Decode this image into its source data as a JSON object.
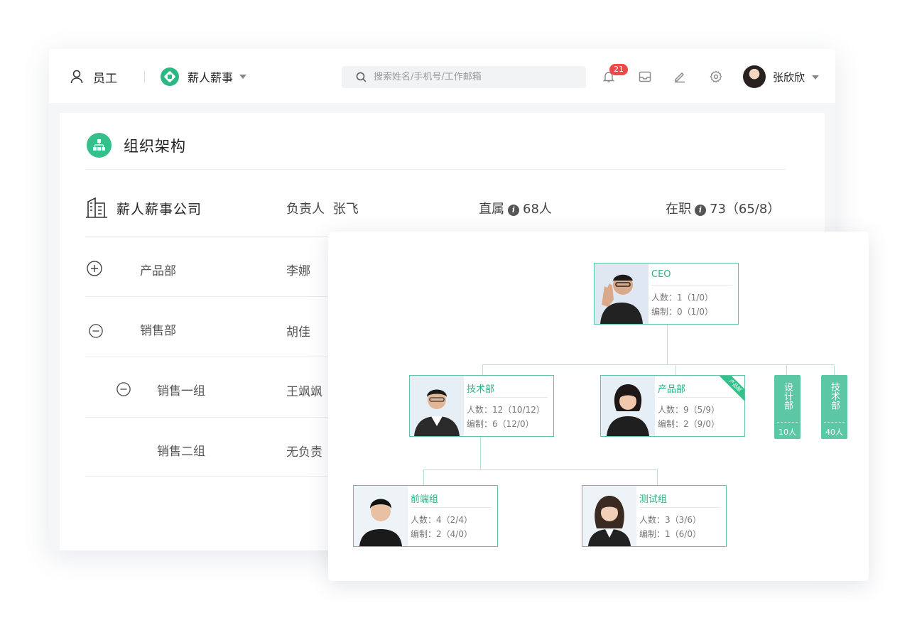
{
  "topbar": {
    "nav_label": "员工",
    "company_name": "薪人薪事",
    "search_placeholder": "搜索姓名/手机号/工作邮箱",
    "notification_count": "21",
    "user_name": "张欣欣"
  },
  "panel": {
    "title": "组织架构",
    "company_row": {
      "name": "薪人薪事公司",
      "leader_label": "负责人",
      "leader_name": "张飞",
      "direct_label": "直属",
      "direct_value": "68人",
      "active_label": "在职",
      "active_value": "73（65/8）"
    },
    "departments": [
      {
        "name": "产品部",
        "leader": "李娜",
        "state": "collapsed"
      },
      {
        "name": "销售部",
        "leader": "胡佳",
        "state": "expanded"
      },
      {
        "name": "销售一组",
        "leader": "王飒飒",
        "state": "expanded"
      },
      {
        "name": "销售二组",
        "leader": "无负责"
      }
    ]
  },
  "org_chart": {
    "ceo": {
      "title": "CEO",
      "line1": "人数：1（1/0）",
      "line2": "编制：0（1/0）"
    },
    "tech": {
      "title": "技术部",
      "line1": "人数：12（10/12）",
      "line2": "编制：6（12/0）"
    },
    "product": {
      "title": "产品部",
      "line1": "人数：9（5/9）",
      "line2": "编制：2（9/0）",
      "ribbon": "产品部"
    },
    "design_collapsed": {
      "name": "设计部",
      "count": "10人"
    },
    "tech_collapsed": {
      "name": "技术部",
      "count": "40人"
    },
    "frontend": {
      "title": "前端组",
      "line1": "人数：4（2/4）",
      "line2": "编制：2（4/0）"
    },
    "qa": {
      "title": "测试组",
      "line1": "人数：3（3/6）",
      "line2": "编制：1（6/0）"
    }
  },
  "colors": {
    "accent": "#34c08a",
    "badge": "#f04848"
  }
}
